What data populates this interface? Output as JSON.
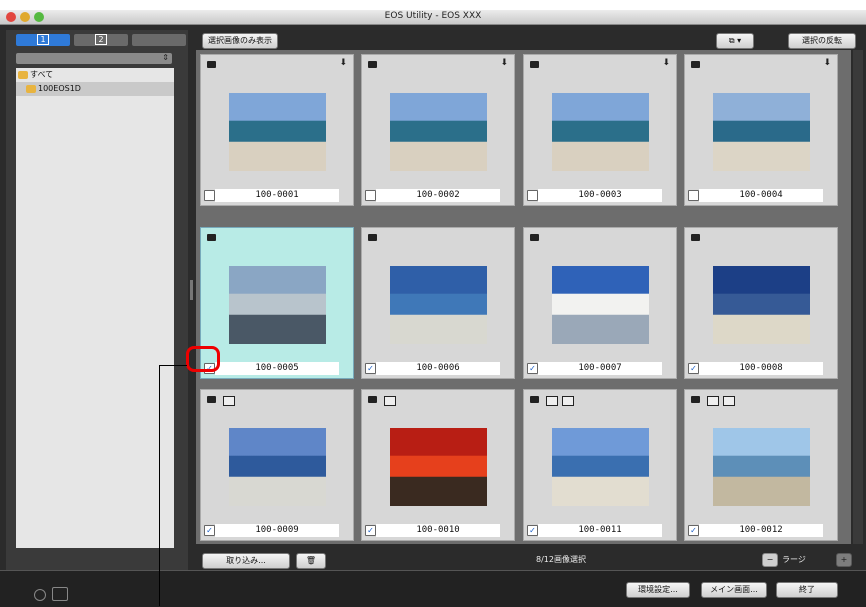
{
  "window": {
    "title": "EOS Utility - EOS XXX"
  },
  "sidebar": {
    "tabs": [
      {
        "label": "1"
      },
      {
        "label": "2"
      },
      {
        "label": ""
      }
    ],
    "tree": [
      {
        "label": "すべて",
        "icon": "folder-icon"
      },
      {
        "label": "100EOS1D",
        "icon": "folder-icon"
      }
    ]
  },
  "toolbar": {
    "show_selected_label": "選択画像のみ表示",
    "invert_selection_label": "選択の反転"
  },
  "thumbnails": [
    {
      "name": "100-0001",
      "checked": false,
      "selected": false,
      "colors": [
        "#7fa6d8",
        "#2b6f8a",
        "#d9d0c0"
      ]
    },
    {
      "name": "100-0002",
      "checked": false,
      "selected": false,
      "colors": [
        "#7fa6d8",
        "#2b6f8a",
        "#d9d0c0"
      ]
    },
    {
      "name": "100-0003",
      "checked": false,
      "selected": false,
      "colors": [
        "#7fa6d8",
        "#2b6f8a",
        "#d9d0c0"
      ]
    },
    {
      "name": "100-0004",
      "checked": false,
      "selected": false,
      "colors": [
        "#8fb0d8",
        "#2a6a8a",
        "#dcd5c6"
      ]
    },
    {
      "name": "100-0005",
      "checked": true,
      "selected": true,
      "colors": [
        "#8aa6c4",
        "#b8c4cc",
        "#4a5866"
      ]
    },
    {
      "name": "100-0006",
      "checked": true,
      "selected": false,
      "colors": [
        "#2f5fa8",
        "#3f78b8",
        "#d8d8d0"
      ]
    },
    {
      "name": "100-0007",
      "checked": true,
      "selected": false,
      "colors": [
        "#2f62b8",
        "#f2f2f0",
        "#9aa8b8"
      ]
    },
    {
      "name": "100-0008",
      "checked": true,
      "selected": false,
      "colors": [
        "#1c3f86",
        "#365a96",
        "#ddd8c8"
      ]
    },
    {
      "name": "100-0009",
      "checked": true,
      "selected": false,
      "colors": [
        "#5f86c8",
        "#2e5a9c",
        "#d8d8d2"
      ]
    },
    {
      "name": "100-0010",
      "checked": true,
      "selected": false,
      "colors": [
        "#b81e14",
        "#e6401c",
        "#3a2a20"
      ]
    },
    {
      "name": "100-0011",
      "checked": true,
      "selected": false,
      "colors": [
        "#6f9ad8",
        "#3a6fb0",
        "#e2ddd0"
      ]
    },
    {
      "name": "100-0012",
      "checked": true,
      "selected": false,
      "colors": [
        "#9fc6e8",
        "#5d8fb8",
        "#c2b8a0"
      ]
    }
  ],
  "bottombar": {
    "import_label": "取り込み...",
    "status": "8/12画像選択",
    "size_label": "ラージ"
  },
  "footer": {
    "prefs_label": "環境設定...",
    "main_label": "メイン画面...",
    "quit_label": "終了"
  }
}
